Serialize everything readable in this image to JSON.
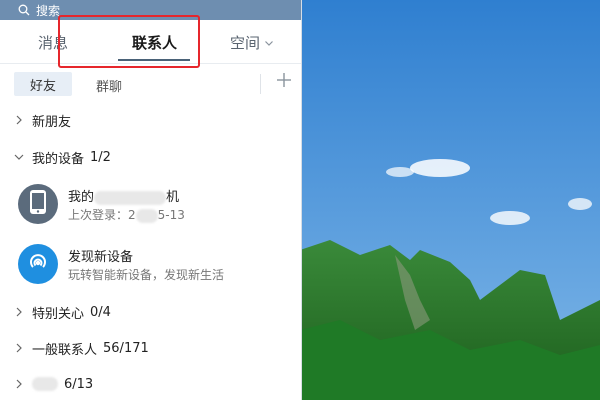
{
  "search": {
    "placeholder": "搜索"
  },
  "tabs": [
    {
      "label": "消息"
    },
    {
      "label": "联系人"
    },
    {
      "label": "空间"
    }
  ],
  "subtabs": [
    {
      "label": "好友"
    },
    {
      "label": "群聊"
    }
  ],
  "groups": {
    "new_friends": {
      "label": "新朋友"
    },
    "my_devices": {
      "label": "我的设备",
      "count": "1/2"
    },
    "special_care": {
      "label": "特别关心",
      "count": "0/4"
    },
    "general_contacts": {
      "label": "一般联系人",
      "count": "56/171"
    },
    "last_group": {
      "count": "6/13"
    }
  },
  "contacts": [
    {
      "name_prefix": "我的",
      "name_suffix": "机",
      "sub_prefix": "上次登录：2",
      "sub_suffix": "5-13"
    },
    {
      "name": "发现新设备",
      "sub": "玩转智能新设备，发现新生活"
    }
  ],
  "icons": {
    "search": "search-icon",
    "chevron": "chevron-down-icon",
    "add": "plus-icon",
    "phone": "phone-icon",
    "discover": "signal-icon"
  },
  "colors": {
    "highlight": "#e6262c",
    "search_bar": "#6e8eb0",
    "phone_avatar": "#5b6b7c",
    "discover_avatar": "#1f8fe0"
  }
}
